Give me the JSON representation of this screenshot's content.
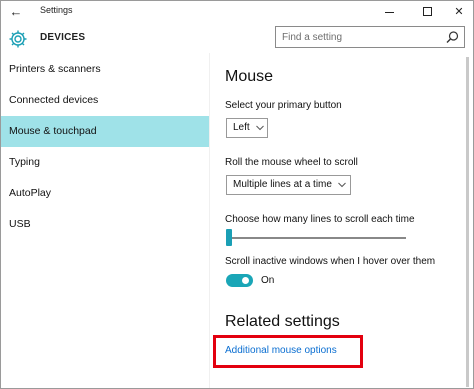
{
  "window": {
    "title": "Settings"
  },
  "header": {
    "title": "DEVICES"
  },
  "search": {
    "placeholder": "Find a setting"
  },
  "sidebar": {
    "items": [
      {
        "label": "Printers & scanners"
      },
      {
        "label": "Connected devices"
      },
      {
        "label": "Mouse & touchpad",
        "selected": true
      },
      {
        "label": "Typing"
      },
      {
        "label": "AutoPlay"
      },
      {
        "label": "USB"
      }
    ]
  },
  "main": {
    "heading": "Mouse",
    "primary_button": {
      "label": "Select your primary button",
      "value": "Left"
    },
    "scroll": {
      "label": "Roll the mouse wheel to scroll",
      "value": "Multiple lines at a time"
    },
    "lines": {
      "label": "Choose how many lines to scroll each time",
      "level": 0.0
    },
    "inactive": {
      "label": "Scroll inactive windows when I hover over them",
      "state": "On"
    },
    "related_heading": "Related settings",
    "link": "Additional mouse options"
  },
  "colors": {
    "accent": "#1aa6b7",
    "selected_bg": "#9fe2e8",
    "link": "#0a6ed1",
    "highlight": "#e3000f"
  },
  "icons": [
    "back-arrow-icon",
    "gear-icon",
    "search-icon",
    "chevron-down-icon"
  ]
}
